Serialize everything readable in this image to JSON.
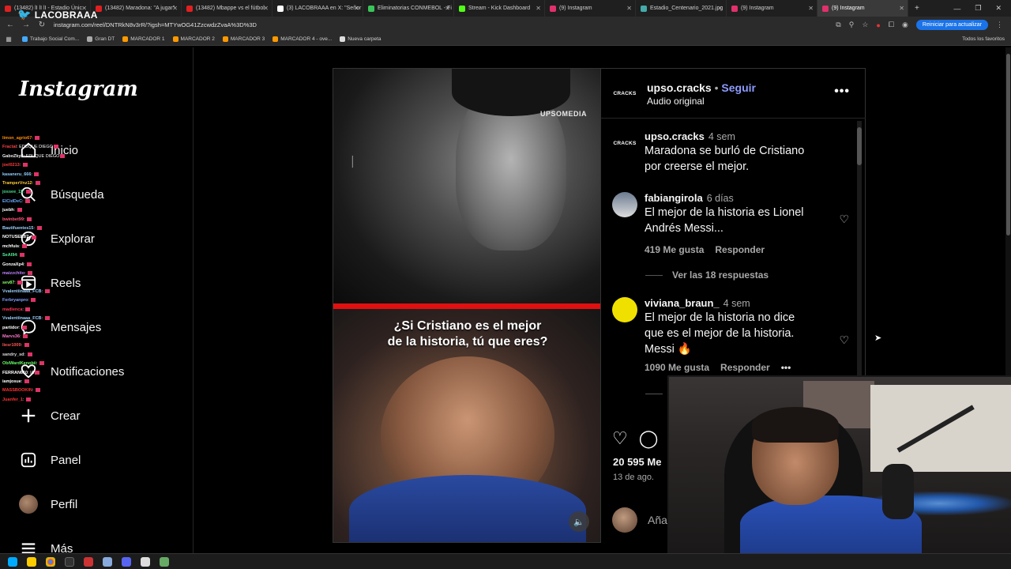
{
  "browser": {
    "tabs": [
      {
        "label": "(13482) lI lI lI - Estadio Únic",
        "color": "#e02020"
      },
      {
        "label": "(13482) Maradona: \"A jugar\"",
        "color": "#e02020"
      },
      {
        "label": "(13482) Mbappe vs el fútbol",
        "color": "#e02020"
      },
      {
        "label": "(3) LACOBRAAA en X: \"Señor",
        "color": "#ffffff"
      },
      {
        "label": "Eliminatorias CONMEBOL - Fi",
        "color": "#3bc45a"
      },
      {
        "label": "Stream - Kick Dashboard",
        "color": "#53fc18"
      },
      {
        "label": "(9) Instagram",
        "color": "#e1306c"
      },
      {
        "label": "Estadio_Centenario_2021.jpg",
        "color": "#4aa"
      },
      {
        "label": "(9) Instagram",
        "color": "#e1306c"
      },
      {
        "label": "(9) Instagram",
        "color": "#e1306c"
      }
    ],
    "url": "instagram.com/reel/DNTRkN8v3rR/?igsh=MTYwOG41ZzcwdzZvaA%3D%3D",
    "update_button": "Reiniciar para actualizar",
    "bookmarks": [
      "Trabajo Social Com...",
      "Gran DT",
      "MARCADOR 1",
      "MARCADOR 2",
      "MARCADOR 3",
      "MARCADOR 4 - ove...",
      "Nueva carpeta"
    ],
    "all_bookmarks": "Todos los favoritos"
  },
  "stream": {
    "channel": "LACOBRAAA"
  },
  "instagram": {
    "logo": "Instagram",
    "nav": [
      {
        "label": "Inicio",
        "icon": "home-icon"
      },
      {
        "label": "Búsqueda",
        "icon": "search-icon"
      },
      {
        "label": "Explorar",
        "icon": "compass-icon"
      },
      {
        "label": "Reels",
        "icon": "reels-icon"
      },
      {
        "label": "Mensajes",
        "icon": "messenger-icon"
      },
      {
        "label": "Notificaciones",
        "icon": "heart-icon"
      },
      {
        "label": "Crear",
        "icon": "plus-icon"
      },
      {
        "label": "Panel",
        "icon": "dashboard-icon"
      },
      {
        "label": "Perfil",
        "icon": "avatar"
      },
      {
        "label": "Más",
        "icon": "menu-icon"
      }
    ]
  },
  "chat": [
    {
      "user": "limon_agrio67",
      "msg": "",
      "color": "#ff8c00"
    },
    {
      "user": "Fractal",
      "msg": "EDUQUE DIEGO",
      "color": "#ff4040"
    },
    {
      "user": "GaboZkyll",
      "msg": "EDUQUE DIEGO",
      "color": "#f0f0f0"
    },
    {
      "user": "joel0213",
      "msg": "",
      "color": "#ff3b3b"
    },
    {
      "user": "kasaneru_666",
      "msg": "",
      "color": "#8fd0ff"
    },
    {
      "user": "TramperVnz12",
      "msg": "",
      "color": "#ffcc33"
    },
    {
      "user": "jossee_15",
      "msg": "",
      "color": "#44dd88"
    },
    {
      "user": "ElCidDeC",
      "msg": "",
      "color": "#66aaff"
    },
    {
      "user": "juebh",
      "msg": "",
      "color": "#ffffff"
    },
    {
      "user": "bwinbet99",
      "msg": "",
      "color": "#ff5577"
    },
    {
      "user": "Bautifuentes15",
      "msg": "",
      "color": "#a0d0ff"
    },
    {
      "user": "NOTUSER87",
      "msg": "",
      "color": "#ffffff"
    },
    {
      "user": "mchfuis",
      "msg": "",
      "color": "#ffffff"
    },
    {
      "user": "SeAl94",
      "msg": "",
      "color": "#55ee99"
    },
    {
      "user": "GonzaXp4",
      "msg": "",
      "color": "#ffffff"
    },
    {
      "user": "maizzchito",
      "msg": "",
      "color": "#c080ff"
    },
    {
      "user": "sev87",
      "msg": "",
      "color": "#88ff66"
    },
    {
      "user": "Vvalentiinaaa_FCB",
      "msg": "",
      "color": "#9ad0ff"
    },
    {
      "user": "Ferbryanpro",
      "msg": "",
      "color": "#7f9fff"
    },
    {
      "user": "madlenca",
      "msg": "",
      "color": "#ff3355"
    },
    {
      "user": "Vvalentiinaaa_FCB",
      "msg": "",
      "color": "#9ad0ff"
    },
    {
      "user": "partidor",
      "msg": "",
      "color": "#ffffff"
    },
    {
      "user": "Marvs36",
      "msg": "",
      "color": "#ff77cc"
    },
    {
      "user": "liesr1009",
      "msg": "",
      "color": "#ff5555"
    },
    {
      "user": "sandry_sd",
      "msg": "",
      "color": "#dddddd"
    },
    {
      "user": "ObiWardKenobii",
      "msg": "",
      "color": "#66ff66"
    },
    {
      "user": "FERRAN610",
      "msg": "IA",
      "color": "#ffffff"
    },
    {
      "user": "iamjosue",
      "msg": "",
      "color": "#ffffff"
    },
    {
      "user": "MASSBOOKIN",
      "msg": "",
      "color": "#ff3333"
    },
    {
      "user": "Juanfer_1",
      "msg": "",
      "color": "#ff3333"
    }
  ],
  "reel": {
    "watermark": "UPSOMEDIA",
    "caption_line1": "¿Si Cristiano es el mejor",
    "caption_line2": "de la historia, tú que eres?"
  },
  "post": {
    "author": "upso.cracks",
    "author_avatar_text": "CRACKS",
    "follow": "Seguir",
    "audio": "Audio original",
    "caption_time": "4 sem",
    "caption": "Maradona se burló de Cristiano por creerse el mejor.",
    "comments": [
      {
        "user": "fabiangirola",
        "time": "6 días",
        "text": "El mejor de la historia es Lionel Andrés Messi...",
        "likes": "419 Me gusta",
        "reply": "Responder",
        "avatar_color": "#6a7a90"
      },
      {
        "user": "viviana_braun_",
        "time": "4 sem",
        "text": "El mejor de la historia no dice que es el mejor de la historia. Messi 🔥",
        "likes": "1090 Me gusta",
        "reply": "Responder",
        "avatar_color": "#f0e000"
      }
    ],
    "view_replies": "Ver las 18 respuestas",
    "likes_total": "20 595 Me",
    "date": "13 de ago.",
    "add_comment": "Aña"
  }
}
